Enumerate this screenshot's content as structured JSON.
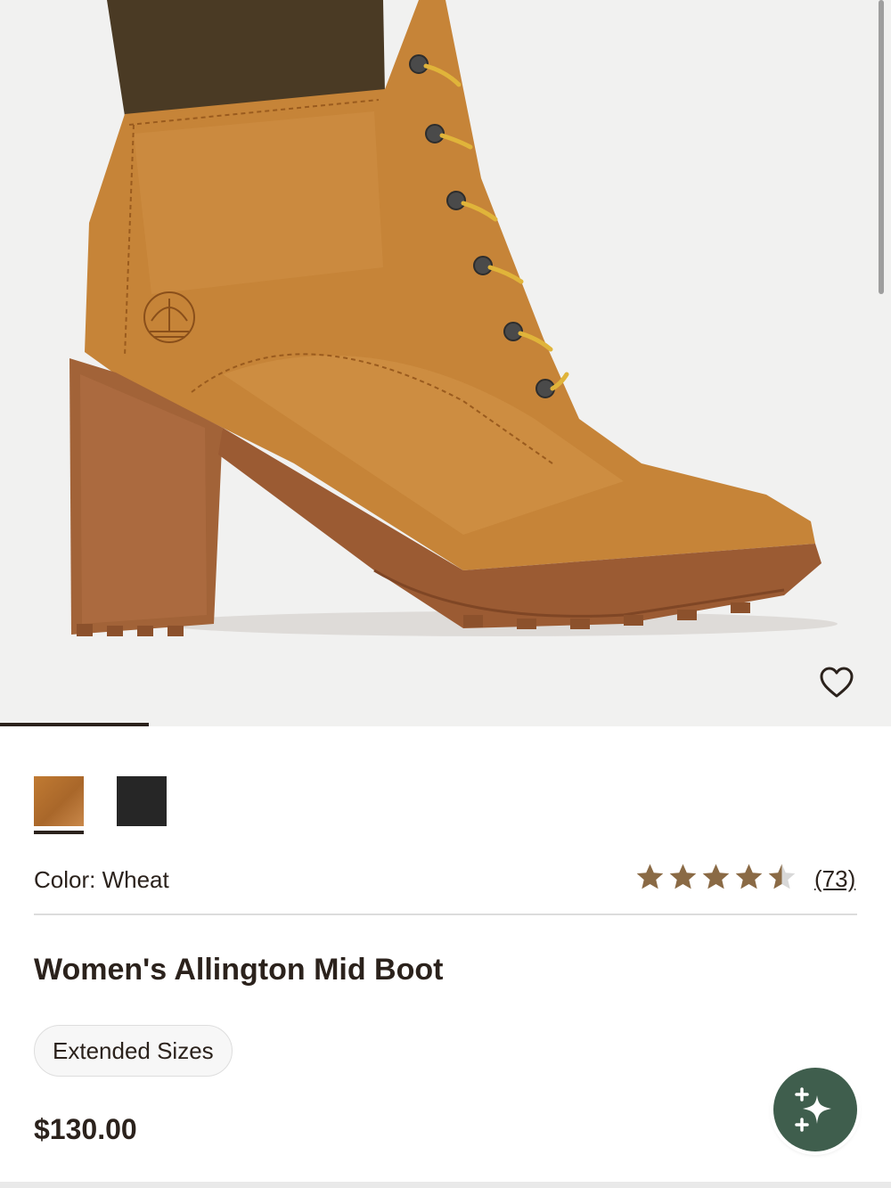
{
  "product": {
    "name": "Women's Allington Mid Boot",
    "price": "$130.00",
    "color_label": "Color: Wheat",
    "review_count": "(73)",
    "rating": 4.5,
    "max_rating": 5,
    "tag": "Extended Sizes"
  },
  "gallery": {
    "image_icon": "boot-product-image",
    "progress_fraction": 0.167
  },
  "swatches": [
    {
      "name": "Wheat",
      "color": "#b87330",
      "selected": true
    },
    {
      "name": "Black",
      "color": "#262626",
      "selected": false
    }
  ],
  "icons": {
    "wishlist": "heart-outline-icon",
    "assistant": "sparkle-icon",
    "star": "star-icon"
  },
  "colors": {
    "text": "#2b221c",
    "star_filled": "#8a6a45",
    "star_empty": "#d8d8d8",
    "fab": "#3f5e4d"
  }
}
